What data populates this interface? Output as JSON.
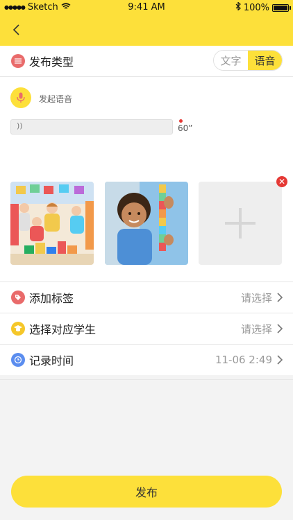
{
  "status_bar": {
    "carrier": "Sketch",
    "time": "9:41 AM",
    "battery": "100%"
  },
  "post_type": {
    "label": "发布类型",
    "options": [
      "文字",
      "语音"
    ],
    "selected": "语音"
  },
  "voice": {
    "start_label": "发起语音",
    "duration": "60”"
  },
  "rows": {
    "tags": {
      "label": "添加标签",
      "value": "请选择"
    },
    "student": {
      "label": "选择对应学生",
      "value": "请选择"
    },
    "time": {
      "label": "记录时间",
      "value": "11-06 2:49"
    }
  },
  "publish_label": "发布",
  "colors": {
    "accent": "#fde03a",
    "tag_icon": "#e96b6b",
    "student_icon": "#f5c72a",
    "time_icon": "#5b8def",
    "delete": "#e53935"
  }
}
